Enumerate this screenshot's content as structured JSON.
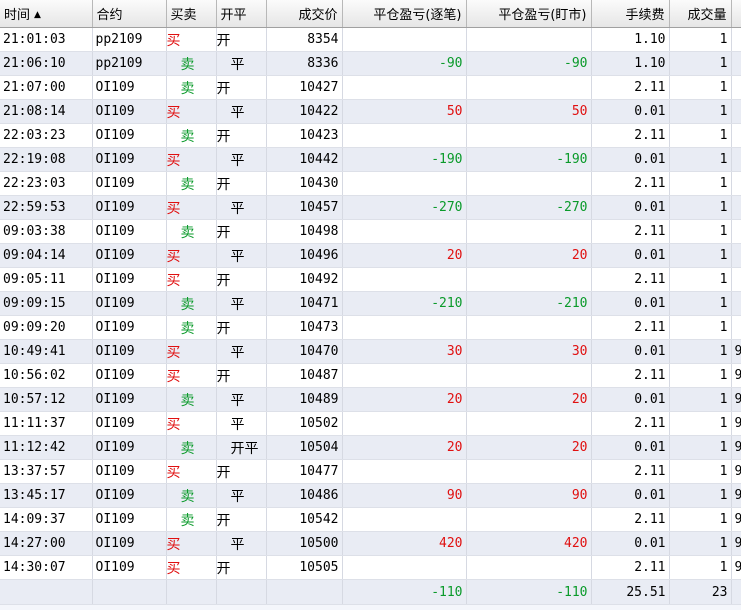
{
  "headers": [
    "时间",
    "合约",
    "买卖",
    "开平",
    "成交价",
    "平仓盈亏(逐笔)",
    "平仓盈亏(盯市)",
    "手续费",
    "成交量",
    ""
  ],
  "sort_indicator": "▲",
  "colors": {
    "buy": "#e01010",
    "sell": "#0a9a2a",
    "profit": "#e01010",
    "loss": "#0a9a2a"
  },
  "rows": [
    {
      "time": "21:01:03",
      "contract": "pp2109",
      "side": "买",
      "oc": "开",
      "price": "8354",
      "pnl_trade": "",
      "pnl_mtm": "",
      "fee": "1.10",
      "vol": "1",
      "extra": ""
    },
    {
      "time": "21:06:10",
      "contract": "pp2109",
      "side": "卖",
      "oc": "平",
      "price": "8336",
      "pnl_trade": "-90",
      "pnl_mtm": "-90",
      "fee": "1.10",
      "vol": "1",
      "extra": ""
    },
    {
      "time": "21:07:00",
      "contract": "OI109",
      "side": "卖",
      "oc": "开",
      "price": "10427",
      "pnl_trade": "",
      "pnl_mtm": "",
      "fee": "2.11",
      "vol": "1",
      "extra": ""
    },
    {
      "time": "21:08:14",
      "contract": "OI109",
      "side": "买",
      "oc": "平",
      "price": "10422",
      "pnl_trade": "50",
      "pnl_mtm": "50",
      "fee": "0.01",
      "vol": "1",
      "extra": ""
    },
    {
      "time": "22:03:23",
      "contract": "OI109",
      "side": "卖",
      "oc": "开",
      "price": "10423",
      "pnl_trade": "",
      "pnl_mtm": "",
      "fee": "2.11",
      "vol": "1",
      "extra": ""
    },
    {
      "time": "22:19:08",
      "contract": "OI109",
      "side": "买",
      "oc": "平",
      "price": "10442",
      "pnl_trade": "-190",
      "pnl_mtm": "-190",
      "fee": "0.01",
      "vol": "1",
      "extra": ""
    },
    {
      "time": "22:23:03",
      "contract": "OI109",
      "side": "卖",
      "oc": "开",
      "price": "10430",
      "pnl_trade": "",
      "pnl_mtm": "",
      "fee": "2.11",
      "vol": "1",
      "extra": ""
    },
    {
      "time": "22:59:53",
      "contract": "OI109",
      "side": "买",
      "oc": "平",
      "price": "10457",
      "pnl_trade": "-270",
      "pnl_mtm": "-270",
      "fee": "0.01",
      "vol": "1",
      "extra": ""
    },
    {
      "time": "09:03:38",
      "contract": "OI109",
      "side": "卖",
      "oc": "开",
      "price": "10498",
      "pnl_trade": "",
      "pnl_mtm": "",
      "fee": "2.11",
      "vol": "1",
      "extra": ""
    },
    {
      "time": "09:04:14",
      "contract": "OI109",
      "side": "买",
      "oc": "平",
      "price": "10496",
      "pnl_trade": "20",
      "pnl_mtm": "20",
      "fee": "0.01",
      "vol": "1",
      "extra": ""
    },
    {
      "time": "09:05:11",
      "contract": "OI109",
      "side": "买",
      "oc": "开",
      "price": "10492",
      "pnl_trade": "",
      "pnl_mtm": "",
      "fee": "2.11",
      "vol": "1",
      "extra": ""
    },
    {
      "time": "09:09:15",
      "contract": "OI109",
      "side": "卖",
      "oc": "平",
      "price": "10471",
      "pnl_trade": "-210",
      "pnl_mtm": "-210",
      "fee": "0.01",
      "vol": "1",
      "extra": ""
    },
    {
      "time": "09:09:20",
      "contract": "OI109",
      "side": "卖",
      "oc": "开",
      "price": "10473",
      "pnl_trade": "",
      "pnl_mtm": "",
      "fee": "2.11",
      "vol": "1",
      "extra": ""
    },
    {
      "time": "10:49:41",
      "contract": "OI109",
      "side": "买",
      "oc": "平",
      "price": "10470",
      "pnl_trade": "30",
      "pnl_mtm": "30",
      "fee": "0.01",
      "vol": "1",
      "extra": "9"
    },
    {
      "time": "10:56:02",
      "contract": "OI109",
      "side": "买",
      "oc": "开",
      "price": "10487",
      "pnl_trade": "",
      "pnl_mtm": "",
      "fee": "2.11",
      "vol": "1",
      "extra": "9"
    },
    {
      "time": "10:57:12",
      "contract": "OI109",
      "side": "卖",
      "oc": "平",
      "price": "10489",
      "pnl_trade": "20",
      "pnl_mtm": "20",
      "fee": "0.01",
      "vol": "1",
      "extra": "9"
    },
    {
      "time": "11:11:37",
      "contract": "OI109",
      "side": "买",
      "oc": "平",
      "price": "10502",
      "pnl_trade": "",
      "pnl_mtm": "",
      "fee": "2.11",
      "vol": "1",
      "extra": "9"
    },
    {
      "time": "11:12:42",
      "contract": "OI109",
      "side": "卖",
      "oc": "开平",
      "price": "10504",
      "pnl_trade": "20",
      "pnl_mtm": "20",
      "fee": "0.01",
      "vol": "1",
      "extra": "9"
    },
    {
      "time": "13:37:57",
      "contract": "OI109",
      "side": "买",
      "oc": "开",
      "price": "10477",
      "pnl_trade": "",
      "pnl_mtm": "",
      "fee": "2.11",
      "vol": "1",
      "extra": "9"
    },
    {
      "time": "13:45:17",
      "contract": "OI109",
      "side": "卖",
      "oc": "平",
      "price": "10486",
      "pnl_trade": "90",
      "pnl_mtm": "90",
      "fee": "0.01",
      "vol": "1",
      "extra": "9"
    },
    {
      "time": "14:09:37",
      "contract": "OI109",
      "side": "卖",
      "oc": "开",
      "price": "10542",
      "pnl_trade": "",
      "pnl_mtm": "",
      "fee": "2.11",
      "vol": "1",
      "extra": "9"
    },
    {
      "time": "14:27:00",
      "contract": "OI109",
      "side": "买",
      "oc": "平",
      "price": "10500",
      "pnl_trade": "420",
      "pnl_mtm": "420",
      "fee": "0.01",
      "vol": "1",
      "extra": "9"
    },
    {
      "time": "14:30:07",
      "contract": "OI109",
      "side": "买",
      "oc": "开",
      "price": "10505",
      "pnl_trade": "",
      "pnl_mtm": "",
      "fee": "2.11",
      "vol": "1",
      "extra": "9"
    }
  ],
  "totals": {
    "pnl_trade": "-110",
    "pnl_mtm": "-110",
    "fee": "25.51",
    "vol": "23"
  }
}
